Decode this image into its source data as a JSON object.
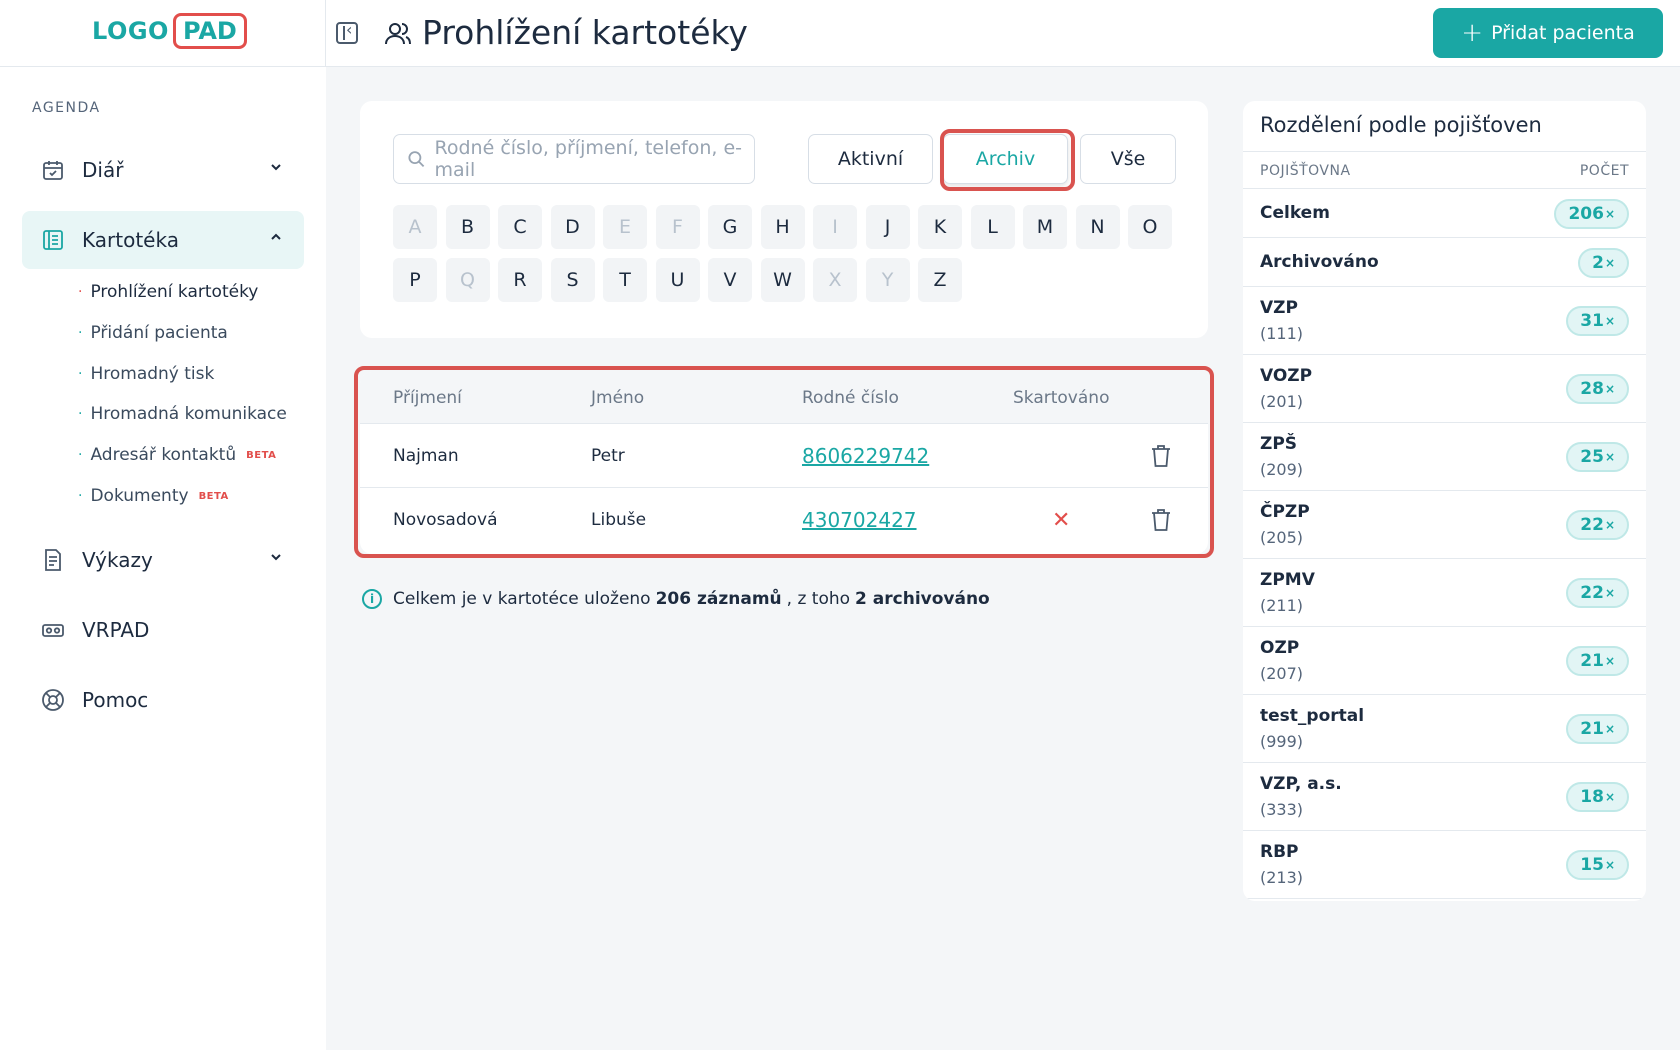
{
  "header": {
    "logo_left": "LOGO",
    "logo_right": "PAD",
    "title": "Prohlížení kartotéky",
    "add_button": "Přidat pacienta"
  },
  "sidebar": {
    "section": "AGENDA",
    "items": [
      {
        "label": "Diář",
        "icon": "calendar-icon"
      },
      {
        "label": "Kartotéka",
        "icon": "folder-list-icon"
      },
      {
        "label": "Výkazy",
        "icon": "report-icon"
      },
      {
        "label": "VRPAD",
        "icon": "vr-headset-icon"
      },
      {
        "label": "Pomoc",
        "icon": "lifebuoy-icon"
      }
    ],
    "subitems": [
      {
        "label": "Prohlížení kartotéky",
        "badge": ""
      },
      {
        "label": "Přidání pacienta",
        "badge": ""
      },
      {
        "label": "Hromadný tisk",
        "badge": ""
      },
      {
        "label": "Hromadná komunikace",
        "badge": ""
      },
      {
        "label": "Adresář kontaktů",
        "badge": "BETA"
      },
      {
        "label": "Dokumenty",
        "badge": "BETA"
      }
    ]
  },
  "search": {
    "placeholder": "Rodné číslo, příjmení, telefon, e-mail",
    "filters": [
      "Aktivní",
      "Archiv",
      "Vše"
    ],
    "selected_filter": "Archiv"
  },
  "alphabet": {
    "row1": [
      "A",
      "B",
      "C",
      "D",
      "E",
      "F",
      "G",
      "H",
      "I",
      "J",
      "K",
      "L",
      "M",
      "N",
      "O"
    ],
    "row2": [
      "P",
      "Q",
      "R",
      "S",
      "T",
      "U",
      "V",
      "W",
      "X",
      "Y",
      "Z"
    ],
    "disabled": [
      "A",
      "E",
      "F",
      "I",
      "Q",
      "X",
      "Y"
    ]
  },
  "table": {
    "columns": [
      "Příjmení",
      "Jméno",
      "Rodné číslo",
      "Skartováno"
    ],
    "rows": [
      {
        "surname": "Najman",
        "name": "Petr",
        "birth_number": "8606229742",
        "shredded": ""
      },
      {
        "surname": "Novosadová",
        "name": "Libuše",
        "birth_number": "430702427",
        "shredded": "✕"
      }
    ]
  },
  "info": {
    "text1": "Celkem je v kartotéce uloženo",
    "count": "206 záznamů",
    "text2": ", z toho",
    "archived": "2 archivováno"
  },
  "insurance": {
    "title": "Rozdělení podle pojišťoven",
    "col_left": "POJIŠŤOVNA",
    "col_right": "POČET",
    "rows": [
      {
        "name": "Celkem",
        "code": "",
        "count": "206"
      },
      {
        "name": "Archivováno",
        "code": "",
        "count": "2"
      },
      {
        "name": "VZP",
        "code": "(111)",
        "count": "31"
      },
      {
        "name": "VOZP",
        "code": "(201)",
        "count": "28"
      },
      {
        "name": "ZPŠ",
        "code": "(209)",
        "count": "25"
      },
      {
        "name": "ČPZP",
        "code": "(205)",
        "count": "22"
      },
      {
        "name": "ZPMV",
        "code": "(211)",
        "count": "22"
      },
      {
        "name": "OZP",
        "code": "(207)",
        "count": "21"
      },
      {
        "name": "test_portal",
        "code": "(999)",
        "count": "21"
      },
      {
        "name": "VZP, a.s.",
        "code": "(333)",
        "count": "18"
      },
      {
        "name": "RBP",
        "code": "(213)",
        "count": "15"
      }
    ],
    "count_suffix": "×"
  },
  "colors": {
    "accent": "#1aa7a4",
    "highlight": "#d9534f"
  }
}
